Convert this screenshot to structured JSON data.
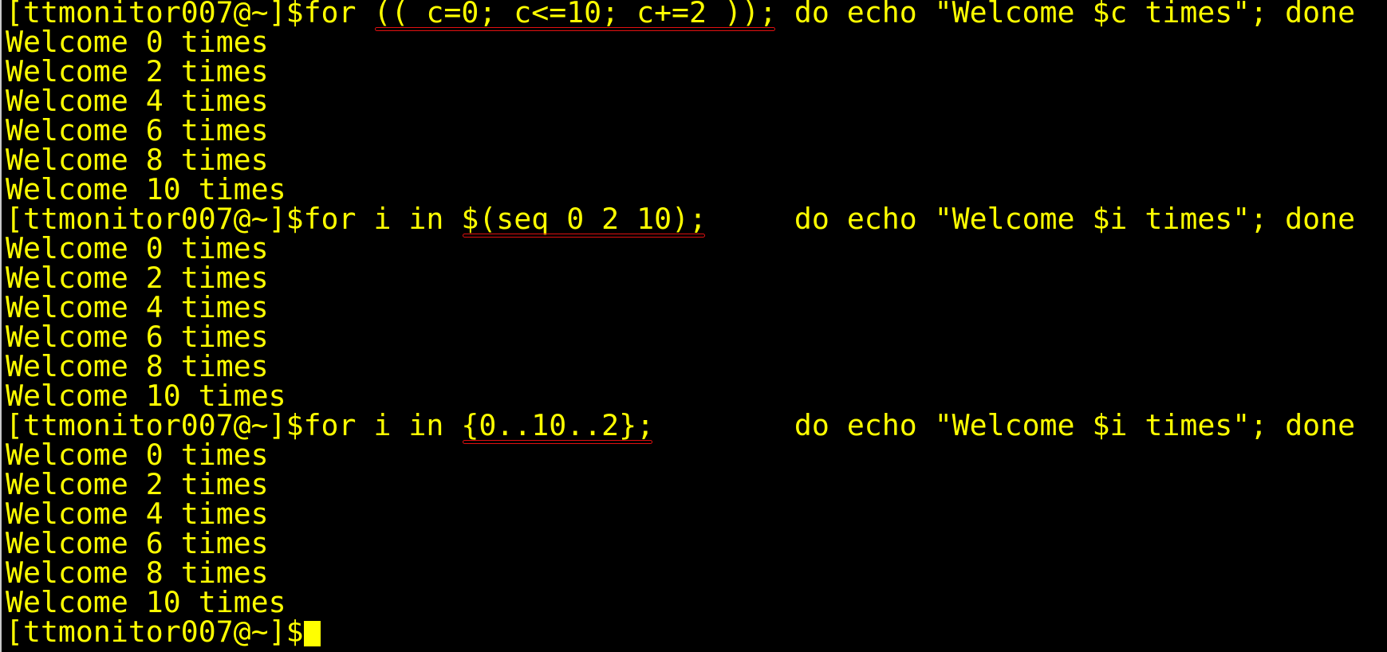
{
  "terminal": {
    "text_color": "#ffff00",
    "background": "#000000",
    "highlight_color": "#e01010",
    "lines": [
      {
        "type": "command",
        "prefix": "[ttmonitor007@~]$for ",
        "highlight": "(( c=0; c<=10; c+=2 ));",
        "suffix": " do echo \"Welcome $c times\"; done"
      },
      {
        "type": "output",
        "text": "Welcome 0 times"
      },
      {
        "type": "output",
        "text": "Welcome 2 times"
      },
      {
        "type": "output",
        "text": "Welcome 4 times"
      },
      {
        "type": "output",
        "text": "Welcome 6 times"
      },
      {
        "type": "output",
        "text": "Welcome 8 times"
      },
      {
        "type": "output",
        "text": "Welcome 10 times"
      },
      {
        "type": "command",
        "prefix": "[ttmonitor007@~]$for i in ",
        "highlight": "$(seq 0 2 10);",
        "suffix": "     do echo \"Welcome $i times\"; done"
      },
      {
        "type": "output",
        "text": "Welcome 0 times"
      },
      {
        "type": "output",
        "text": "Welcome 2 times"
      },
      {
        "type": "output",
        "text": "Welcome 4 times"
      },
      {
        "type": "output",
        "text": "Welcome 6 times"
      },
      {
        "type": "output",
        "text": "Welcome 8 times"
      },
      {
        "type": "output",
        "text": "Welcome 10 times"
      },
      {
        "type": "command",
        "prefix": "[ttmonitor007@~]$for i in ",
        "highlight": "{0..10..2};",
        "suffix": "        do echo \"Welcome $i times\"; done"
      },
      {
        "type": "output",
        "text": "Welcome 0 times"
      },
      {
        "type": "output",
        "text": "Welcome 2 times"
      },
      {
        "type": "output",
        "text": "Welcome 4 times"
      },
      {
        "type": "output",
        "text": "Welcome 6 times"
      },
      {
        "type": "output",
        "text": "Welcome 8 times"
      },
      {
        "type": "output",
        "text": "Welcome 10 times"
      },
      {
        "type": "prompt",
        "text": "[ttmonitor007@~]$"
      }
    ]
  }
}
